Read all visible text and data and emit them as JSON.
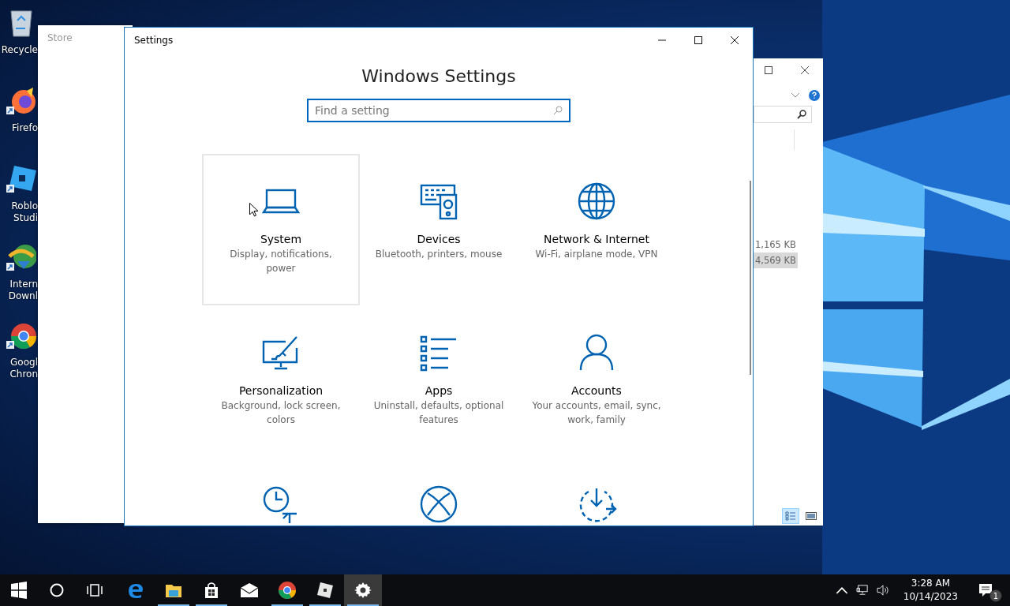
{
  "desktop_icons": [
    {
      "kind": "recycle-bin",
      "label_lines": [
        "Recycle"
      ]
    },
    {
      "kind": "firefox",
      "label_lines": [
        "Firefo"
      ]
    },
    {
      "kind": "roblox-studio",
      "label_lines": [
        "Roblo",
        "Studi"
      ]
    },
    {
      "kind": "download-manager",
      "label_lines": [
        "Intern",
        "Downl"
      ]
    },
    {
      "kind": "chrome",
      "label_lines": [
        "Googl",
        "Chron"
      ]
    }
  ],
  "store_window": {
    "title": "Store"
  },
  "explorer_window": {
    "sizes": [
      {
        "text": "1,165 KB",
        "selected": false
      },
      {
        "text": "4,569 KB",
        "selected": true
      }
    ],
    "view_buttons": [
      {
        "kind": "details",
        "selected": true
      },
      {
        "kind": "preview",
        "selected": false
      }
    ]
  },
  "settings_window": {
    "title": "Settings",
    "heading": "Windows Settings",
    "search": {
      "placeholder": "Find a setting"
    },
    "tiles": [
      {
        "kind": "laptop",
        "title": "System",
        "description": "Display, notifications, power",
        "selected": true
      },
      {
        "kind": "devices",
        "title": "Devices",
        "description": "Bluetooth, printers, mouse",
        "selected": false
      },
      {
        "kind": "globe",
        "title": "Network & Internet",
        "description": "Wi-Fi, airplane mode, VPN",
        "selected": false
      },
      {
        "kind": "personalization",
        "title": "Personalization",
        "description": "Background, lock screen, colors",
        "selected": false
      },
      {
        "kind": "apps",
        "title": "Apps",
        "description": "Uninstall, defaults, optional features",
        "selected": false
      },
      {
        "kind": "person",
        "title": "Accounts",
        "description": "Your accounts, email, sync, work, family",
        "selected": false
      },
      {
        "kind": "time-language",
        "selected": false
      },
      {
        "kind": "xbox",
        "selected": false
      },
      {
        "kind": "update",
        "selected": false
      }
    ]
  },
  "taskbar": {
    "items": [
      {
        "kind": "start",
        "open": false,
        "active": false
      },
      {
        "kind": "search",
        "open": false,
        "active": false
      },
      {
        "kind": "task-view",
        "open": false,
        "active": false
      },
      {
        "kind": "edge",
        "open": false,
        "active": false
      },
      {
        "kind": "folder",
        "open": true,
        "active": false
      },
      {
        "kind": "store",
        "open": true,
        "active": false
      },
      {
        "kind": "mail",
        "open": false,
        "active": false
      },
      {
        "kind": "chrome",
        "open": true,
        "active": false
      },
      {
        "kind": "roblox",
        "open": true,
        "active": false
      },
      {
        "kind": "settings",
        "open": true,
        "active": true
      }
    ],
    "time": "3:28 AM",
    "date": "10/14/2023",
    "notification_count": "1"
  }
}
